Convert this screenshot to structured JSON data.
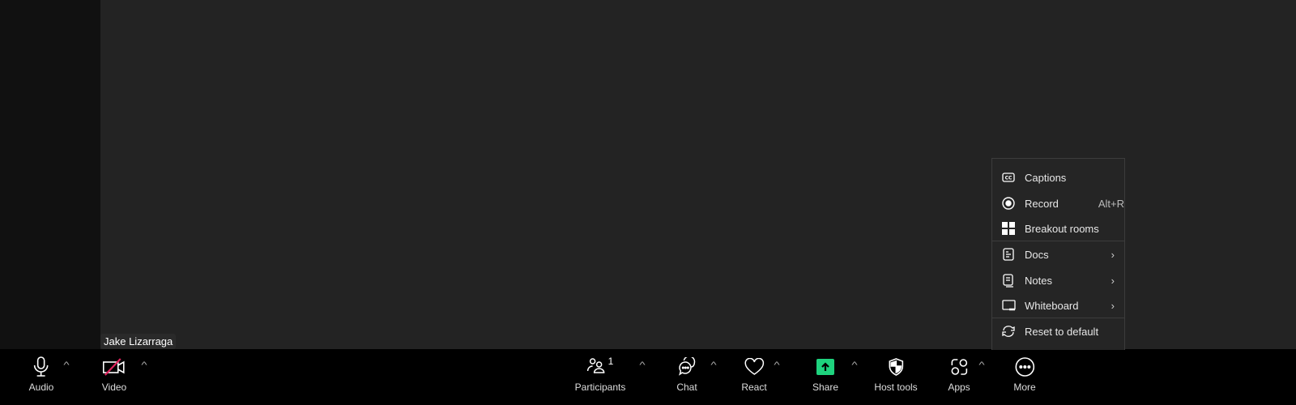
{
  "participant_name": "Jake Lizarraga",
  "toolbar": {
    "audio": "Audio",
    "video": "Video",
    "participants": "Participants",
    "participant_count": "1",
    "chat": "Chat",
    "react": "React",
    "share": "Share",
    "host_tools": "Host tools",
    "apps": "Apps",
    "more": "More"
  },
  "colors": {
    "share_green": "#1ed37e",
    "video_off_red": "#e0245e"
  },
  "menu": {
    "captions": "Captions",
    "record": "Record",
    "record_shortcut": "Alt+R",
    "breakout": "Breakout rooms",
    "docs": "Docs",
    "notes": "Notes",
    "whiteboard": "Whiteboard",
    "reset": "Reset to default"
  }
}
